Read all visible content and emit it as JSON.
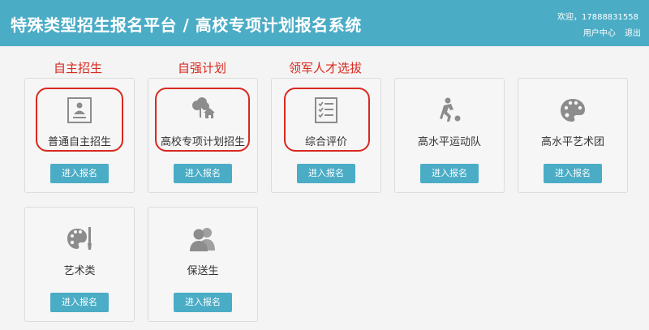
{
  "header": {
    "title": "特殊类型招生报名平台 / 高校专项计划报名系统",
    "welcome": "欢迎，17888831558",
    "user_center": "用户中心",
    "logout": "退出"
  },
  "annotations": [
    "自主招生",
    "自强计划",
    "领军人才选拔"
  ],
  "cards": [
    {
      "label": "普通自主招生",
      "button": "进入报名",
      "icon": "id-card-icon"
    },
    {
      "label": "高校专项计划招生",
      "button": "进入报名",
      "icon": "tree-house-icon"
    },
    {
      "label": "综合评价",
      "button": "进入报名",
      "icon": "checklist-icon"
    },
    {
      "label": "高水平运动队",
      "button": "进入报名",
      "icon": "soccer-player-icon"
    },
    {
      "label": "高水平艺术团",
      "button": "进入报名",
      "icon": "palette-icon"
    },
    {
      "label": "艺术类",
      "button": "进入报名",
      "icon": "palette-brush-icon"
    },
    {
      "label": "保送生",
      "button": "进入报名",
      "icon": "users-icon"
    }
  ],
  "colors": {
    "header": "#4bacc6",
    "button": "#4bacc6",
    "annotation": "#d9281f",
    "icon": "#8c8c8c"
  }
}
